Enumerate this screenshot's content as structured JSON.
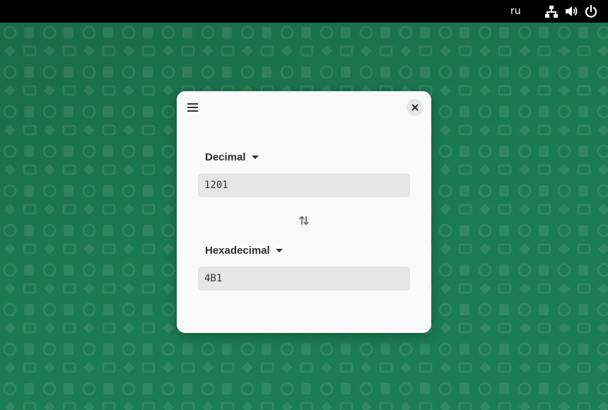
{
  "topbar": {
    "language": "ru",
    "icons": [
      "network-icon",
      "volume-icon",
      "power-icon"
    ]
  },
  "window": {
    "menu_icon": "hamburger-menu-icon",
    "close_icon": "close-icon",
    "swap_icon": "swap-vertical-icon",
    "from_unit": "Decimal",
    "from_value": "1201",
    "to_unit": "Hexadecimal",
    "to_value": "4B1"
  },
  "colors": {
    "wallpaper": "#1b7a52",
    "topbar": "#000000",
    "window_bg": "#fafafa",
    "field_bg": "#e6e6e6"
  }
}
